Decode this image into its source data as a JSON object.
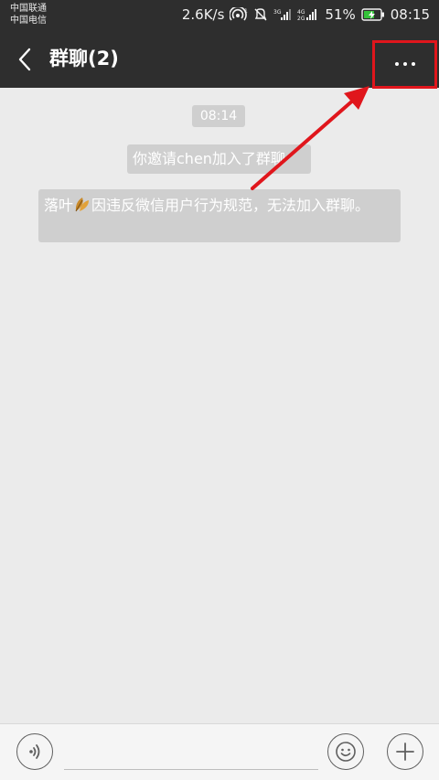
{
  "status_bar": {
    "carrier_1": "中国联通",
    "carrier_2": "中国电信",
    "net_speed": "2.6K/s",
    "battery_percent": "51%",
    "time": "08:15",
    "icons": [
      "hotspot-icon",
      "mute-icon",
      "signal-3g-icon",
      "signal-4g-icon",
      "battery-charging-icon"
    ]
  },
  "header": {
    "title": "群聊(2)",
    "back_icon": "chevron-left-icon",
    "more_icon": "more-dots-icon"
  },
  "messages": {
    "timestamp": "08:14",
    "invite": "你邀请chen加入了群聊",
    "violation_name": "落叶",
    "violation_text": "因违反微信用户行为规范，无法加入群聊。"
  },
  "annotation": {
    "highlight_color": "#e0161c",
    "arrow_color": "#e0161c"
  },
  "input_bar": {
    "voice_icon": "voice-icon",
    "emoji_icon": "emoji-icon",
    "plus_icon": "plus-icon"
  }
}
